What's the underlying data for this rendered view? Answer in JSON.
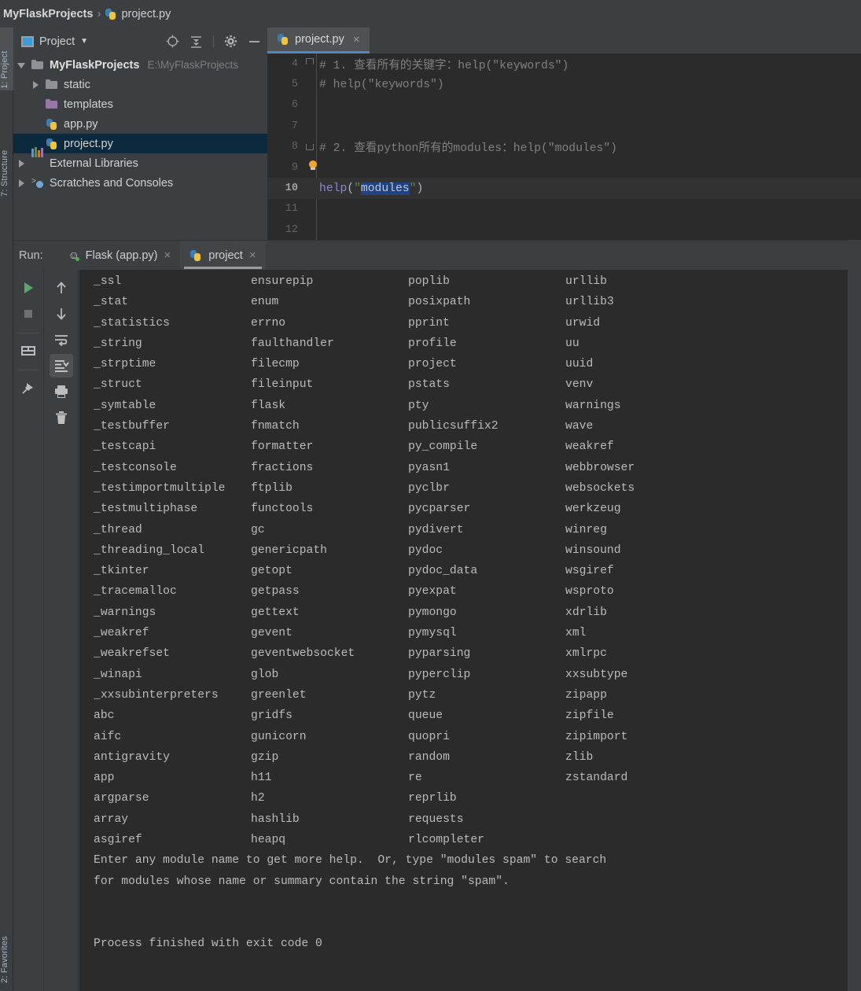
{
  "breadcrumb": {
    "project": "MyFlaskProjects",
    "separator": "›",
    "file": "project.py"
  },
  "left_tool_strip": [
    {
      "label": "1: Project",
      "icon": "project-icon",
      "active": true
    },
    {
      "label": "7: Structure",
      "icon": "structure-icon",
      "active": false
    },
    {
      "label": "2: Favorites",
      "icon": "favorites-icon",
      "active": false
    }
  ],
  "project_panel": {
    "title": "Project",
    "title_chevron": "▼",
    "icons": [
      "locate-icon",
      "collapse-all-icon",
      "settings-gear-icon",
      "minimize-icon"
    ],
    "tree": [
      {
        "label": "MyFlaskProjects",
        "path": "E:\\MyFlaskProjects",
        "icon": "folder-grey-icon",
        "arrow": "down",
        "indent": 0,
        "bold": true,
        "selected": false
      },
      {
        "label": "static",
        "path": "",
        "icon": "folder-grey-icon",
        "arrow": "right",
        "indent": 1,
        "bold": false,
        "selected": false
      },
      {
        "label": "templates",
        "path": "",
        "icon": "folder-purple-icon",
        "arrow": "none",
        "indent": 1,
        "bold": false,
        "selected": false
      },
      {
        "label": "app.py",
        "path": "",
        "icon": "python-file-icon",
        "arrow": "none",
        "indent": 1,
        "bold": false,
        "selected": false
      },
      {
        "label": "project.py",
        "path": "",
        "icon": "python-file-icon",
        "arrow": "none",
        "indent": 1,
        "bold": false,
        "selected": true
      },
      {
        "label": "External Libraries",
        "path": "",
        "icon": "libraries-icon",
        "arrow": "right",
        "indent": 0,
        "bold": false,
        "selected": false
      },
      {
        "label": "Scratches and Consoles",
        "path": "",
        "icon": "scratches-icon",
        "arrow": "right",
        "indent": 0,
        "bold": false,
        "selected": false
      }
    ]
  },
  "editor": {
    "tab": {
      "label": "project.py",
      "icon": "python-file-icon",
      "close": "×"
    },
    "lines": [
      {
        "number": "4",
        "fold": "start",
        "segments": [
          {
            "text": "# 1. 查看所有的关键字：help(\"keywords\")",
            "style": "cmt"
          }
        ]
      },
      {
        "number": "5",
        "fold": "",
        "segments": [
          {
            "text": "# help(\"keywords\")",
            "style": "cmt"
          }
        ]
      },
      {
        "number": "6",
        "fold": "",
        "segments": []
      },
      {
        "number": "7",
        "fold": "",
        "segments": []
      },
      {
        "number": "8",
        "fold": "end",
        "segments": [
          {
            "text": "# 2. 查看python所有的modules：help(\"modules\")",
            "style": "cmt"
          }
        ]
      },
      {
        "number": "9",
        "fold": "bulb",
        "segments": []
      },
      {
        "number": "10",
        "fold": "",
        "current": true,
        "segments": [
          {
            "text": "help",
            "style": "fn"
          },
          {
            "text": "(",
            "style": "pnc"
          },
          {
            "text": "\"",
            "style": "str"
          },
          {
            "text": "modules",
            "style": "sel"
          },
          {
            "text": "\"",
            "style": "str"
          },
          {
            "text": ")",
            "style": "pnc"
          }
        ]
      },
      {
        "number": "11",
        "fold": "",
        "segments": []
      },
      {
        "number": "12",
        "fold": "",
        "segments": []
      }
    ]
  },
  "run_panel": {
    "label": "Run:",
    "tabs": [
      {
        "label": "Flask (app.py)",
        "icon": "flask-running-icon",
        "close": "×",
        "active": false
      },
      {
        "label": "project",
        "icon": "python-file-icon",
        "close": "×",
        "active": true
      }
    ],
    "toolbar_left": [
      {
        "name": "rerun-button",
        "icon": "play-green-icon"
      },
      {
        "name": "stop-button",
        "icon": "stop-square-icon"
      },
      {
        "name": "separator-1",
        "icon": "separator"
      },
      {
        "name": "layout-button",
        "icon": "layout-icon"
      },
      {
        "name": "separator-2",
        "icon": "separator"
      },
      {
        "name": "pin-tab-button",
        "icon": "pin-icon"
      }
    ],
    "toolbar_right": [
      {
        "name": "up-stack-button",
        "icon": "arrow-up-icon"
      },
      {
        "name": "down-stack-button",
        "icon": "arrow-down-icon"
      },
      {
        "name": "soft-wrap-button",
        "icon": "soft-wrap-icon"
      },
      {
        "name": "scroll-to-end-button",
        "icon": "scroll-to-end-icon",
        "selected": true
      },
      {
        "name": "print-button",
        "icon": "printer-icon"
      },
      {
        "name": "clear-all-button",
        "icon": "trash-icon"
      }
    ]
  },
  "console": {
    "module_columns": [
      [
        "_ssl",
        "_stat",
        "_statistics",
        "_string",
        "_strptime",
        "_struct",
        "_symtable",
        "_testbuffer",
        "_testcapi",
        "_testconsole",
        "_testimportmultiple",
        "_testmultiphase",
        "_thread",
        "_threading_local",
        "_tkinter",
        "_tracemalloc",
        "_warnings",
        "_weakref",
        "_weakrefset",
        "_winapi",
        "_xxsubinterpreters",
        "abc",
        "aifc",
        "antigravity",
        "app",
        "argparse",
        "array",
        "asgiref"
      ],
      [
        "ensurepip",
        "enum",
        "errno",
        "faulthandler",
        "filecmp",
        "fileinput",
        "flask",
        "fnmatch",
        "formatter",
        "fractions",
        "ftplib",
        "functools",
        "gc",
        "genericpath",
        "getopt",
        "getpass",
        "gettext",
        "gevent",
        "geventwebsocket",
        "glob",
        "greenlet",
        "gridfs",
        "gunicorn",
        "gzip",
        "h11",
        "h2",
        "hashlib",
        "heapq"
      ],
      [
        "poplib",
        "posixpath",
        "pprint",
        "profile",
        "project",
        "pstats",
        "pty",
        "publicsuffix2",
        "py_compile",
        "pyasn1",
        "pyclbr",
        "pycparser",
        "pydivert",
        "pydoc",
        "pydoc_data",
        "pyexpat",
        "pymongo",
        "pymysql",
        "pyparsing",
        "pyperclip",
        "pytz",
        "queue",
        "quopri",
        "random",
        "re",
        "reprlib",
        "requests",
        "rlcompleter"
      ],
      [
        "urllib",
        "urllib3",
        "urwid",
        "uu",
        "uuid",
        "venv",
        "warnings",
        "wave",
        "weakref",
        "webbrowser",
        "websockets",
        "werkzeug",
        "winreg",
        "winsound",
        "wsgiref",
        "wsproto",
        "xdrlib",
        "xml",
        "xmlrpc",
        "xxsubtype",
        "zipapp",
        "zipfile",
        "zipimport",
        "zlib",
        "zstandard"
      ]
    ],
    "footer_lines": [
      "Enter any module name to get more help.  Or, type \"modules spam\" to search",
      "for modules whose name or summary contain the string \"spam\".",
      "",
      "",
      "Process finished with exit code 0"
    ]
  },
  "colors": {
    "chrome": "#3c3f41",
    "editor_bg": "#2b2b2b",
    "selection_blue": "#214283",
    "tab_underline": "#4a88c7",
    "tree_selection": "#0d293e",
    "comment_grey": "#808080",
    "string_green": "#6a8759",
    "function_purple": "#8888c6"
  }
}
